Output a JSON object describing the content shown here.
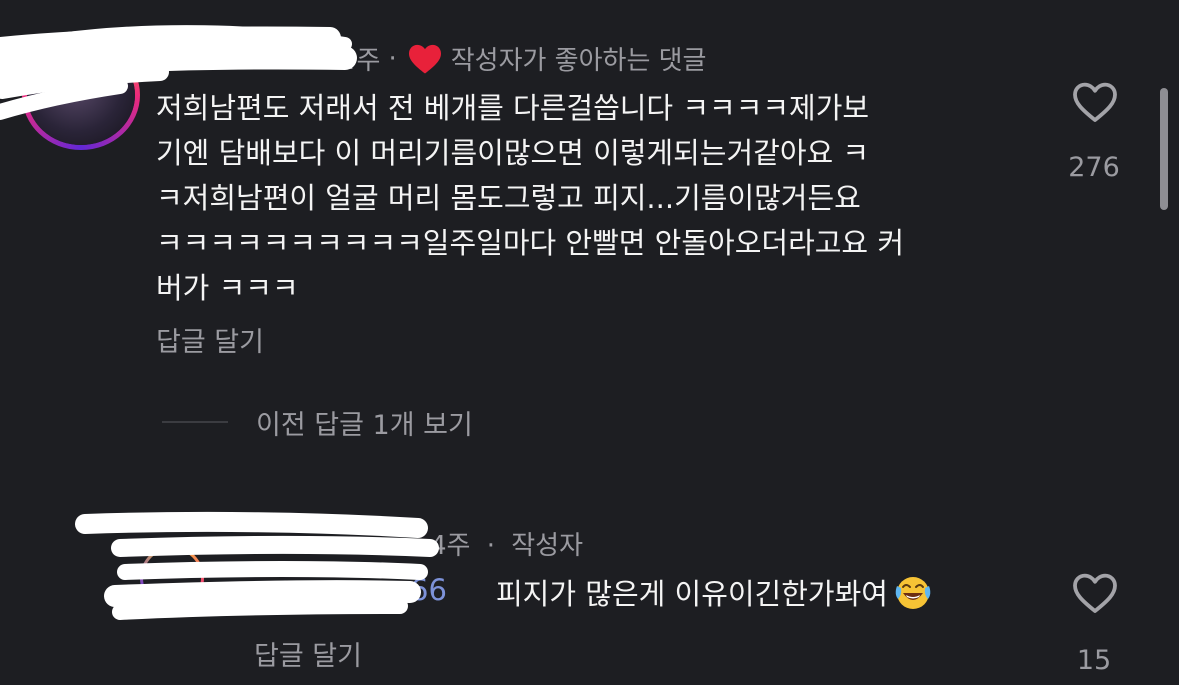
{
  "comment1": {
    "time": "4주",
    "separator": "·",
    "liked_by_creator": "작성자가 좋아하는 댓글",
    "text_lines": [
      "저희남편도 저래서 전 베개를 다른걸씁니다 ㅋㅋㅋㅋ제가보",
      "기엔 담배보다 이 머리기름이많으면 이렇게되는거같아요 ㅋ",
      "ㅋ저희남편이 얼굴 머리 몸도그렇고 피지...기름이많거든요",
      "ㅋㅋㅋㅋㅋㅋㅋㅋㅋㅋ일주일마다 안빨면 안돌아오더라고요 커",
      "버가 ㅋㅋㅋ"
    ],
    "reply_label": "답글 달기",
    "like_count": "276"
  },
  "view_previous": "이전 답글 1개 보기",
  "comment2": {
    "time": "4주",
    "separator": "·",
    "author_badge": "작성자",
    "mention": "66",
    "text": "피지가 많은게 이유이긴한가봐여",
    "reply_label": "답글 달기",
    "like_count": "15"
  },
  "icons": {
    "like": "heart-outline-icon",
    "creator_like": "heart-filled-red-icon",
    "emoji": "face-with-tears-of-joy-icon"
  },
  "colors": {
    "background": "#1d1e22",
    "text": "#f4f4f4",
    "muted": "#9b9ba1",
    "heart_red": "#e8213a",
    "mention": "#7d92d9"
  }
}
